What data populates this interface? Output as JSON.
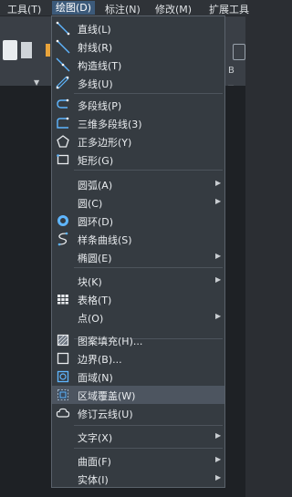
{
  "menubar": {
    "items": [
      "工具(T)",
      "绘图(D)",
      "标注(N)",
      "修改(M)",
      "扩展工具"
    ]
  },
  "draw_menu": {
    "items": [
      {
        "label": "直线(L)",
        "icon": "line-icon"
      },
      {
        "label": "射线(R)",
        "icon": "ray-icon"
      },
      {
        "label": "构造线(T)",
        "icon": "construction-line-icon"
      },
      {
        "label": "多线(U)",
        "icon": "multiline-icon"
      },
      {
        "label": "多段线(P)",
        "icon": "polyline-icon"
      },
      {
        "label": "三维多段线(3)",
        "icon": "3d-polyline-icon"
      },
      {
        "label": "正多边形(Y)",
        "icon": "polygon-icon"
      },
      {
        "label": "矩形(G)",
        "icon": "rectangle-icon"
      },
      {
        "label": "圆弧(A)",
        "icon": "",
        "submenu": true
      },
      {
        "label": "圆(C)",
        "icon": "",
        "submenu": true
      },
      {
        "label": "圆环(D)",
        "icon": "donut-icon"
      },
      {
        "label": "样条曲线(S)",
        "icon": "spline-icon"
      },
      {
        "label": "椭圆(E)",
        "icon": "",
        "submenu": true
      },
      {
        "label": "块(K)",
        "icon": "",
        "submenu": true
      },
      {
        "label": "表格(T)",
        "icon": "table-icon"
      },
      {
        "label": "点(O)",
        "icon": "",
        "submenu": true
      },
      {
        "label": "图案填充(H)...",
        "icon": "hatch-icon"
      },
      {
        "label": "边界(B)...",
        "icon": "boundary-icon"
      },
      {
        "label": "面域(N)",
        "icon": "region-icon"
      },
      {
        "label": "区域覆盖(W)",
        "icon": "wipeout-icon",
        "highlighted": true
      },
      {
        "label": "修订云线(U)",
        "icon": "revcloud-icon"
      },
      {
        "label": "文字(X)",
        "icon": "",
        "submenu": true
      },
      {
        "label": "曲面(F)",
        "icon": "",
        "submenu": true
      },
      {
        "label": "实体(I)",
        "icon": "",
        "submenu": true
      }
    ]
  },
  "ribbon": {
    "right_label": "B"
  }
}
